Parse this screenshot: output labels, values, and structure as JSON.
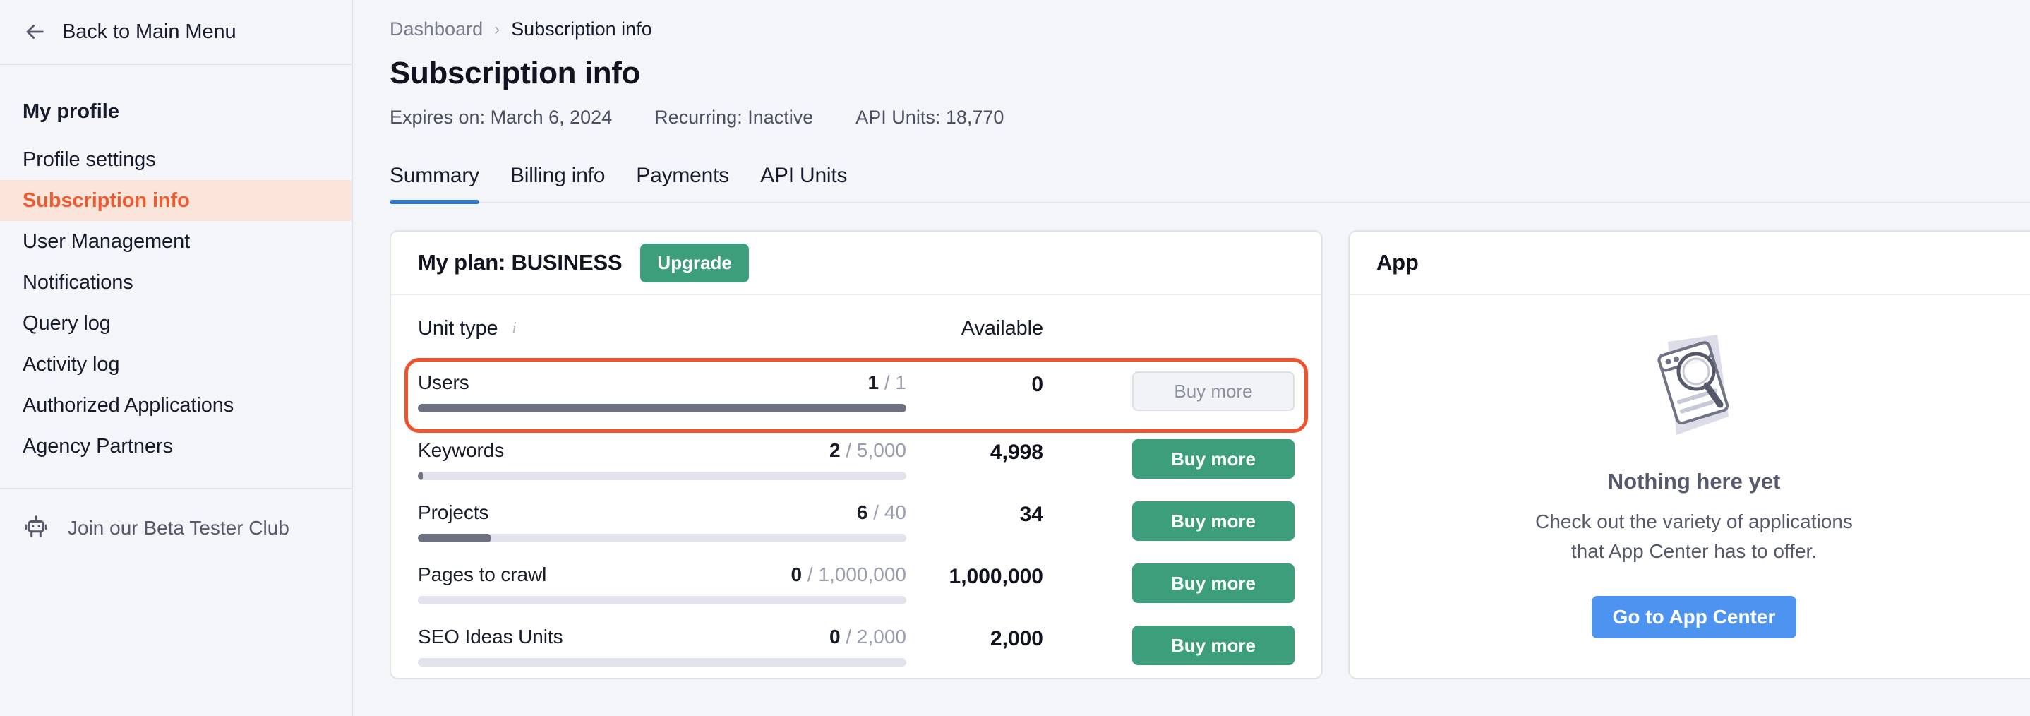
{
  "sidebar": {
    "back_label": "Back to Main Menu",
    "back_icon": "arrow-left-icon",
    "title": "My profile",
    "items": [
      {
        "label": "Profile settings",
        "active": false
      },
      {
        "label": "Subscription info",
        "active": true
      },
      {
        "label": "User Management",
        "active": false
      },
      {
        "label": "Notifications",
        "active": false
      },
      {
        "label": "Query log",
        "active": false
      },
      {
        "label": "Activity log",
        "active": false
      },
      {
        "label": "Authorized Applications",
        "active": false
      },
      {
        "label": "Agency Partners",
        "active": false
      }
    ],
    "beta": {
      "label": "Join our Beta Tester Club",
      "icon": "robot-icon"
    }
  },
  "breadcrumb": {
    "root": "Dashboard",
    "separator": "›",
    "current": "Subscription info"
  },
  "header": {
    "title": "Subscription info",
    "expires": "Expires on: March 6, 2024",
    "recurring": "Recurring: Inactive",
    "api_units": "API Units: 18,770"
  },
  "tabs": [
    {
      "label": "Summary",
      "active": true
    },
    {
      "label": "Billing info",
      "active": false
    },
    {
      "label": "Payments",
      "active": false
    },
    {
      "label": "API Units",
      "active": false
    }
  ],
  "plan_card": {
    "title": "My plan: BUSINESS",
    "upgrade_label": "Upgrade",
    "columns": {
      "unit_type": "Unit type",
      "info_icon": "info-icon",
      "available": "Available"
    },
    "rows": [
      {
        "name": "Users",
        "used": "1",
        "slash": "/",
        "total": "1",
        "available": "0",
        "buy_label": "Buy more",
        "percent": 100,
        "disabled": true,
        "highlighted": true
      },
      {
        "name": "Keywords",
        "used": "2",
        "slash": "/",
        "total": "5,000",
        "available": "4,998",
        "buy_label": "Buy more",
        "percent": 1,
        "disabled": false,
        "highlighted": false
      },
      {
        "name": "Projects",
        "used": "6",
        "slash": "/",
        "total": "40",
        "available": "34",
        "buy_label": "Buy more",
        "percent": 15,
        "disabled": false,
        "highlighted": false
      },
      {
        "name": "Pages to crawl",
        "used": "0",
        "slash": "/",
        "total": "1,000,000",
        "available": "1,000,000",
        "buy_label": "Buy more",
        "percent": 0,
        "disabled": false,
        "highlighted": false
      },
      {
        "name": "SEO Ideas Units",
        "used": "0",
        "slash": "/",
        "total": "2,000",
        "available": "2,000",
        "buy_label": "Buy more",
        "percent": 0,
        "disabled": false,
        "highlighted": false
      }
    ]
  },
  "app_card": {
    "title": "App",
    "illustration_icon": "magnifier-document-icon",
    "empty_title": "Nothing here yet",
    "empty_line1": "Check out the variety of applications",
    "empty_line2": "that App Center has to offer.",
    "cta_label": "Go to App Center"
  },
  "colors": {
    "accent_orange": "#eb5c33",
    "highlight_border": "#f0522b",
    "green": "#3c9e7a",
    "blue": "#4d93f0",
    "tab_underline": "#2e77d0"
  }
}
